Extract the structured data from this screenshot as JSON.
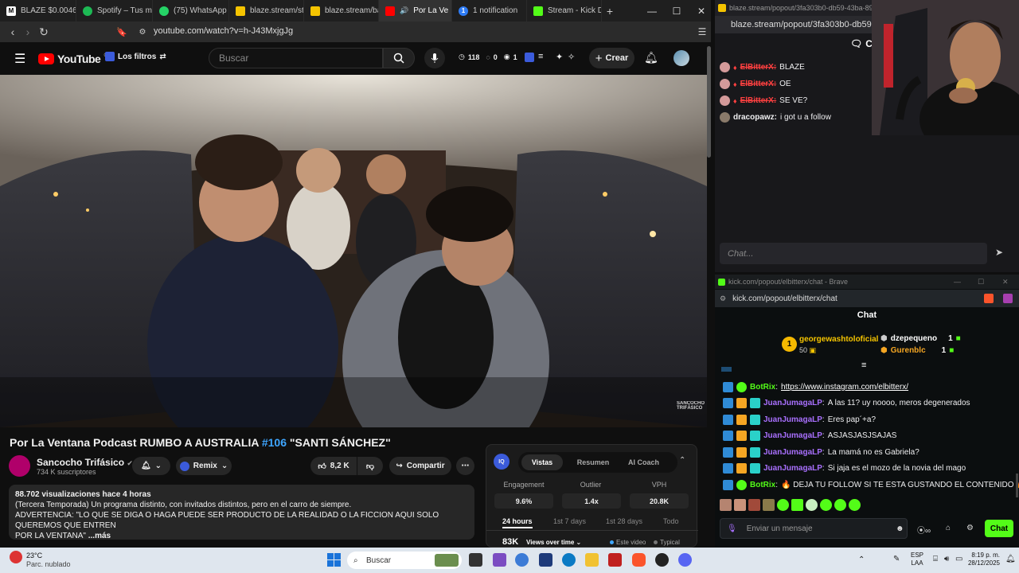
{
  "tabs": [
    {
      "label": "BLAZE $0.00460"
    },
    {
      "label": "Spotify – Tus me"
    },
    {
      "label": "(75) WhatsApp"
    },
    {
      "label": "blaze.stream/stre"
    },
    {
      "label": "blaze.stream/bac"
    },
    {
      "label": "Por La Ve"
    },
    {
      "label": "1 notification"
    },
    {
      "label": "Stream - Kick Da"
    }
  ],
  "address_bar": {
    "url": "youtube.com/watch?v=h-J43MxjgJg"
  },
  "youtube": {
    "logo": "YouTube",
    "logo_sup": "CO",
    "filter_label": "Los filtros",
    "search_placeholder": "Buscar",
    "stats": {
      "count_a": "118",
      "count_b": "0",
      "count_c": "1"
    },
    "create_label": "Crear"
  },
  "video": {
    "title_prefix": "Por La Ventana Podcast RUMBO A AUSTRALIA ",
    "title_tag": "#106",
    "title_suffix": " \"SANTI SÁNCHEZ\"",
    "channel_name": "Sancocho Trifásico",
    "subscribers": "734 K suscriptores",
    "remix_label": "Remix",
    "likes": "8,2 K",
    "share_label": "Compartir",
    "views_line": "88.702 visualizaciones  hace 4 horas",
    "desc_line1": "(Tercera Temporada) Un programa distinto, con invitados distintos, pero en el carro de siempre.",
    "desc_line2": "ADVERTENCIA: \"LO QUE SE DIGA O HAGA PUEDE SER PRODUCTO DE LA REALIDAD O LA FICCION AQUI SOLO QUEREMOS QUE ENTREN",
    "desc_line3": "POR LA VENTANA\"",
    "more_label": "...más",
    "watermark": "SANCOCHO TRIFÁSICO"
  },
  "analytics": {
    "tabs": [
      "Vistas",
      "Resumen",
      "AI Coach"
    ],
    "labels": [
      "Engagement",
      "Outlier",
      "VPH"
    ],
    "values": [
      "9.6%",
      "1.4x",
      "20.8K"
    ],
    "periods": [
      "24 hours",
      "1st 7 days",
      "1st 28 days",
      "Todo"
    ],
    "views_value": "83K",
    "views_dropdown": "Views over time",
    "legend_this": "Este video",
    "legend_typical": "Typical"
  },
  "blaze_chat": {
    "window_url": "blaze.stream/popout/3fa303b0-db59-43ba-89b5-96",
    "url": "blaze.stream/popout/3fa303b0-db59-43ba-8",
    "header": "Ch",
    "messages": [
      {
        "user": "ElBitterX:",
        "text": "BLAZE"
      },
      {
        "user": "ElBitterX:",
        "text": "OE"
      },
      {
        "user": "ElBitterX:",
        "text": "SE VE?"
      },
      {
        "user": "dracopawz:",
        "text": "i got u a follow"
      }
    ],
    "input_placeholder": "Chat..."
  },
  "kick_chat": {
    "window_title": "kick.com/popout/elbitterx/chat - Brave",
    "url": "kick.com/popout/elbitterx/chat",
    "header": "Chat",
    "leader_rank": "1",
    "leader_name": "georgewashtoloficial",
    "leader_count": "50",
    "side_users": [
      {
        "name": "dzepequeno",
        "count": "1"
      },
      {
        "name": "Gurenblc",
        "count": "1"
      }
    ],
    "messages": [
      {
        "user": "BotRix",
        "text": "https://www.instagram.com/elbitterx/",
        "link": true
      },
      {
        "user": "JuanJumagaLP",
        "text": "A las 11? uy noooo, meros degenerados"
      },
      {
        "user": "JuanJumagaLP",
        "text": "Eres pap´+a?"
      },
      {
        "user": "JuanJumagaLP",
        "text": "ASJASJASJSAJAS"
      },
      {
        "user": "JuanJumagaLP",
        "text": "La mamá no es Gabriela?"
      },
      {
        "user": "JuanJumagaLP",
        "text": "Si jaja es el mozo de la novia del mago"
      },
      {
        "user": "BotRix",
        "text": "🔥 DEJA TU FOLLOW SI TE ESTA GUSTANDO EL CONTENIDO 🔥"
      }
    ],
    "input_placeholder": "Enviar un mensaje",
    "chat_button": "Chat"
  },
  "taskbar": {
    "weather_temp": "23°C",
    "weather_desc": "Parc. nublado",
    "search_placeholder": "Buscar",
    "lang_top": "ESP",
    "lang_bottom": "LAA",
    "time": "8:19 p. m.",
    "date": "28/12/2025"
  },
  "colors": {
    "youtube_red": "#ff0000",
    "kick_green": "#53fc18",
    "blaze_user": "#ff4040",
    "kick_user": "#a970ff"
  }
}
